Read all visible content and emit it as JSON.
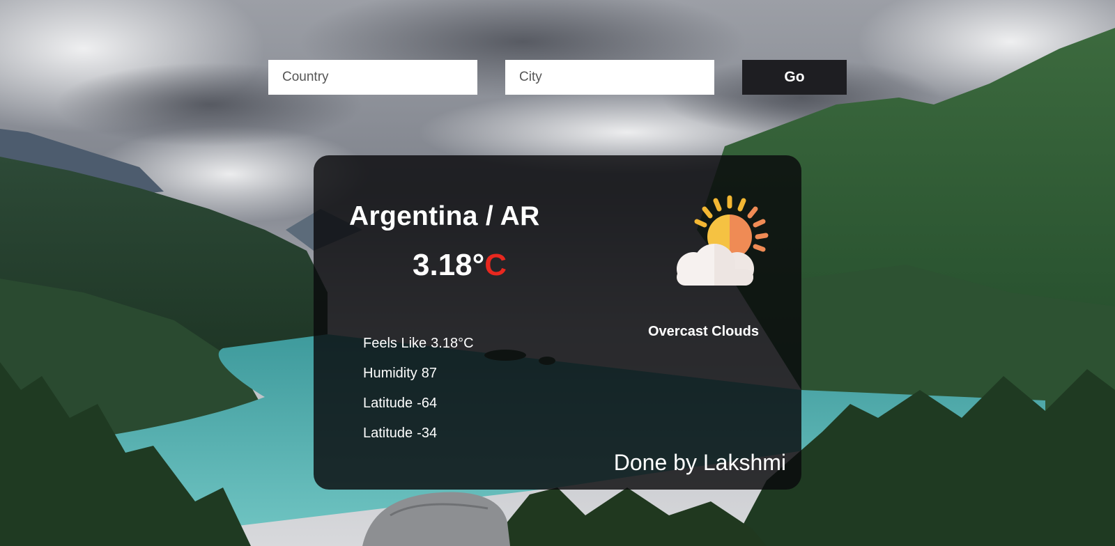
{
  "search": {
    "country_placeholder": "Country",
    "city_placeholder": "City",
    "go_label": "Go"
  },
  "weather": {
    "location": "Argentina / AR",
    "temp_value": "3.18°",
    "temp_unit": "C",
    "condition": "Overcast Clouds",
    "icon": "partly-cloudy-icon",
    "details": {
      "feels_like": {
        "label": "Feels Like",
        "value": "3.18°C"
      },
      "humidity": {
        "label": "Humidity",
        "value": "87"
      },
      "latitude_1": {
        "label": "Latitude",
        "value": "-64"
      },
      "latitude_2": {
        "label": "Latitude",
        "value": "-34"
      }
    }
  },
  "footer": {
    "credit": "Done by Lakshmi"
  },
  "colors": {
    "temp_unit": "#e8281f",
    "button_bg": "#1e1e22",
    "card_bg": "rgba(10,10,12,0.82)"
  }
}
